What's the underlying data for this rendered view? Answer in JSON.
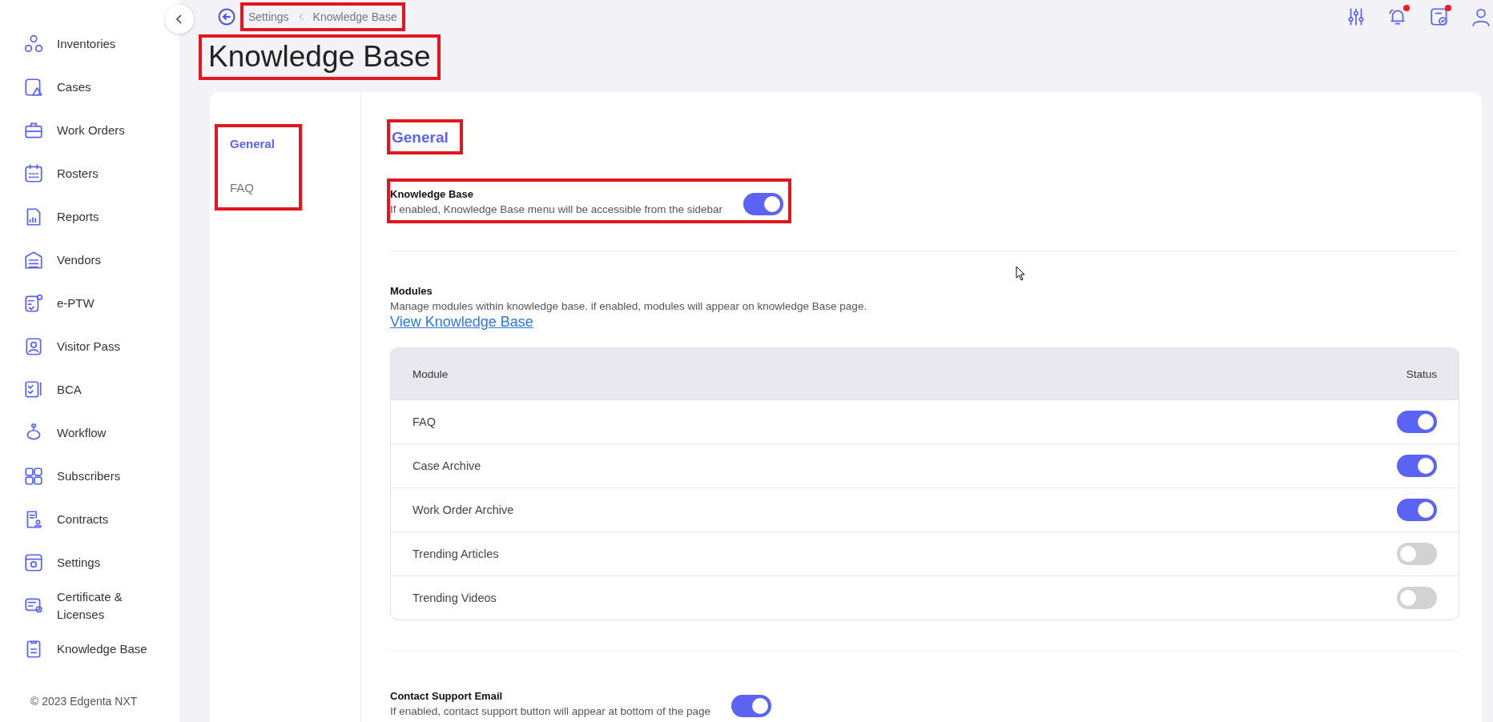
{
  "sidebar": {
    "items": [
      {
        "label": "Inventories"
      },
      {
        "label": "Cases"
      },
      {
        "label": "Work Orders"
      },
      {
        "label": "Rosters"
      },
      {
        "label": "Reports"
      },
      {
        "label": "Vendors"
      },
      {
        "label": "e-PTW"
      },
      {
        "label": "Visitor Pass"
      },
      {
        "label": "BCA"
      },
      {
        "label": "Workflow"
      },
      {
        "label": "Subscribers"
      },
      {
        "label": "Contracts"
      },
      {
        "label": "Settings"
      },
      {
        "label": "Certificate & Licenses"
      },
      {
        "label": "Knowledge Base"
      }
    ],
    "footer": "© 2023 Edgenta NXT"
  },
  "header": {
    "breadcrumb": {
      "highlighted": true,
      "items": [
        "Settings",
        "Knowledge Base"
      ]
    },
    "actions": [
      {
        "badge": false
      },
      {
        "badge": true
      },
      {
        "badge": true
      },
      {
        "badge": false
      }
    ]
  },
  "page_title": {
    "text": "Knowledge Base",
    "highlighted": true
  },
  "settings_nav": {
    "highlighted": true,
    "items": [
      {
        "label": "General",
        "selected": true
      },
      {
        "label": "FAQ",
        "selected": false
      }
    ]
  },
  "section": {
    "title": "General",
    "highlighted": true
  },
  "knowledge_base": {
    "title": "Knowledge Base",
    "description": "If enabled, Knowledge Base menu will be accessible from the sidebar",
    "on": true,
    "highlighted": true
  },
  "modules": {
    "title": "Modules",
    "description": "Manage modules within knowledge base. if enabled, modules will appear on knowledge Base page.",
    "link": "View Knowledge Base",
    "table": {
      "columns": [
        "Module",
        "Status"
      ],
      "rows": [
        {
          "name": "FAQ",
          "on": true
        },
        {
          "name": "Case Archive",
          "on": true
        },
        {
          "name": "Work Order Archive",
          "on": true
        },
        {
          "name": "Trending Articles",
          "on": false
        },
        {
          "name": "Trending Videos",
          "on": false
        }
      ]
    }
  },
  "contact_support": {
    "title": "Contact Support Email",
    "description": "If enabled, contact support button will appear at bottom of the page",
    "on": true
  }
}
